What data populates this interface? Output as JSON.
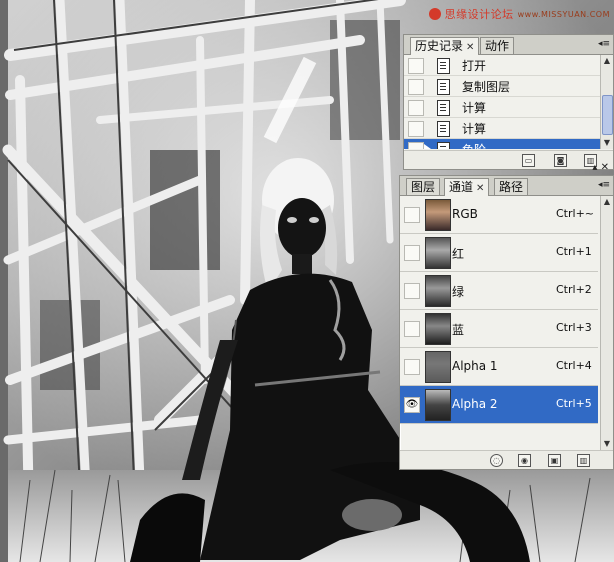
{
  "watermark": {
    "text": "思缘设计论坛",
    "site": "www.MISSYUAN.COM"
  },
  "history_panel": {
    "tabs": [
      {
        "label": "历史记录",
        "active": true
      },
      {
        "label": "动作",
        "active": false
      }
    ],
    "items": [
      {
        "label": "打开",
        "selected": false
      },
      {
        "label": "复制图层",
        "selected": false
      },
      {
        "label": "计算",
        "selected": false
      },
      {
        "label": "计算",
        "selected": false
      },
      {
        "label": "色阶",
        "selected": true
      }
    ],
    "footer_icons": [
      "new-snapshot-icon",
      "camera-icon",
      "trash-icon"
    ]
  },
  "channels_panel": {
    "tabs": [
      {
        "label": "图层",
        "active": false
      },
      {
        "label": "通道",
        "active": true
      },
      {
        "label": "路径",
        "active": false
      }
    ],
    "channels": [
      {
        "name": "RGB",
        "shortcut": "Ctrl+~",
        "visible": false,
        "selected": false
      },
      {
        "name": "红",
        "shortcut": "Ctrl+1",
        "visible": false,
        "selected": false
      },
      {
        "name": "绿",
        "shortcut": "Ctrl+2",
        "visible": false,
        "selected": false
      },
      {
        "name": "蓝",
        "shortcut": "Ctrl+3",
        "visible": false,
        "selected": false
      },
      {
        "name": "Alpha 1",
        "shortcut": "Ctrl+4",
        "visible": false,
        "selected": false
      },
      {
        "name": "Alpha 2",
        "shortcut": "Ctrl+5",
        "visible": true,
        "selected": true
      }
    ],
    "footer_icons": [
      "load-selection-icon",
      "save-selection-icon",
      "new-channel-icon",
      "trash-icon"
    ]
  },
  "colors": {
    "selection": "#316ac5",
    "panel_bg": "#f1f1ec",
    "watermark": "#d43a2a"
  }
}
